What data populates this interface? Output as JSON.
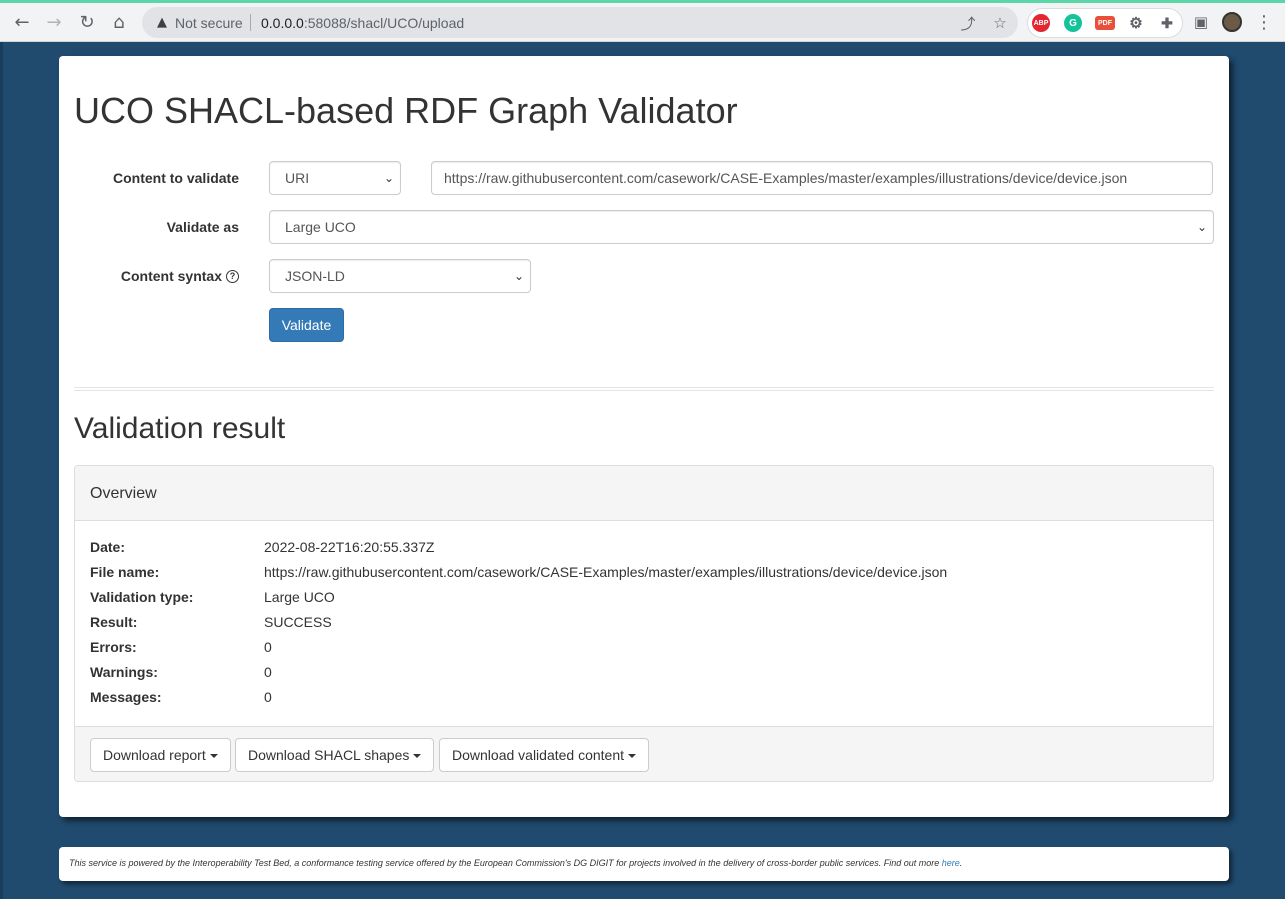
{
  "browser": {
    "security_label": "Not secure",
    "url_host": "0.0.0.0",
    "url_rest": ":58088/shacl/UCO/upload",
    "extensions": [
      {
        "name": "adblock-icon",
        "label": "ABP",
        "color": "#e3262f"
      },
      {
        "name": "grammarly-icon",
        "label": "G",
        "color": "#15c39a"
      },
      {
        "name": "pdf-extension-icon",
        "label": "PDF",
        "color": "#e8503a"
      }
    ]
  },
  "page": {
    "title": "UCO SHACL-based RDF Graph Validator"
  },
  "form": {
    "content_label": "Content to validate",
    "content_type_value": "URI",
    "content_uri_value": "https://raw.githubusercontent.com/casework/CASE-Examples/master/examples/illustrations/device/device.json",
    "validate_as_label": "Validate as",
    "validate_as_value": "Large UCO",
    "syntax_label": "Content syntax",
    "syntax_value": "JSON-LD",
    "help_glyph": "?",
    "submit_label": "Validate"
  },
  "result": {
    "section_title": "Validation result",
    "overview_title": "Overview",
    "rows": [
      {
        "label": "Date:",
        "value": "2022-08-22T16:20:55.337Z"
      },
      {
        "label": "File name:",
        "value": "https://raw.githubusercontent.com/casework/CASE-Examples/master/examples/illustrations/device/device.json"
      },
      {
        "label": "Validation type:",
        "value": "Large UCO"
      },
      {
        "label": "Result:",
        "value": "SUCCESS"
      },
      {
        "label": "Errors:",
        "value": "0"
      },
      {
        "label": "Warnings:",
        "value": "0"
      },
      {
        "label": "Messages:",
        "value": "0"
      }
    ],
    "buttons": {
      "report": "Download report",
      "shapes": "Download SHACL shapes",
      "content": "Download validated content"
    }
  },
  "footer": {
    "text": "This service is powered by the Interoperability Test Bed, a conformance testing service offered by the European Commission's DG DIGIT for projects involved in the delivery of cross-border public services. Find out more ",
    "link_text": "here",
    "tail": "."
  }
}
